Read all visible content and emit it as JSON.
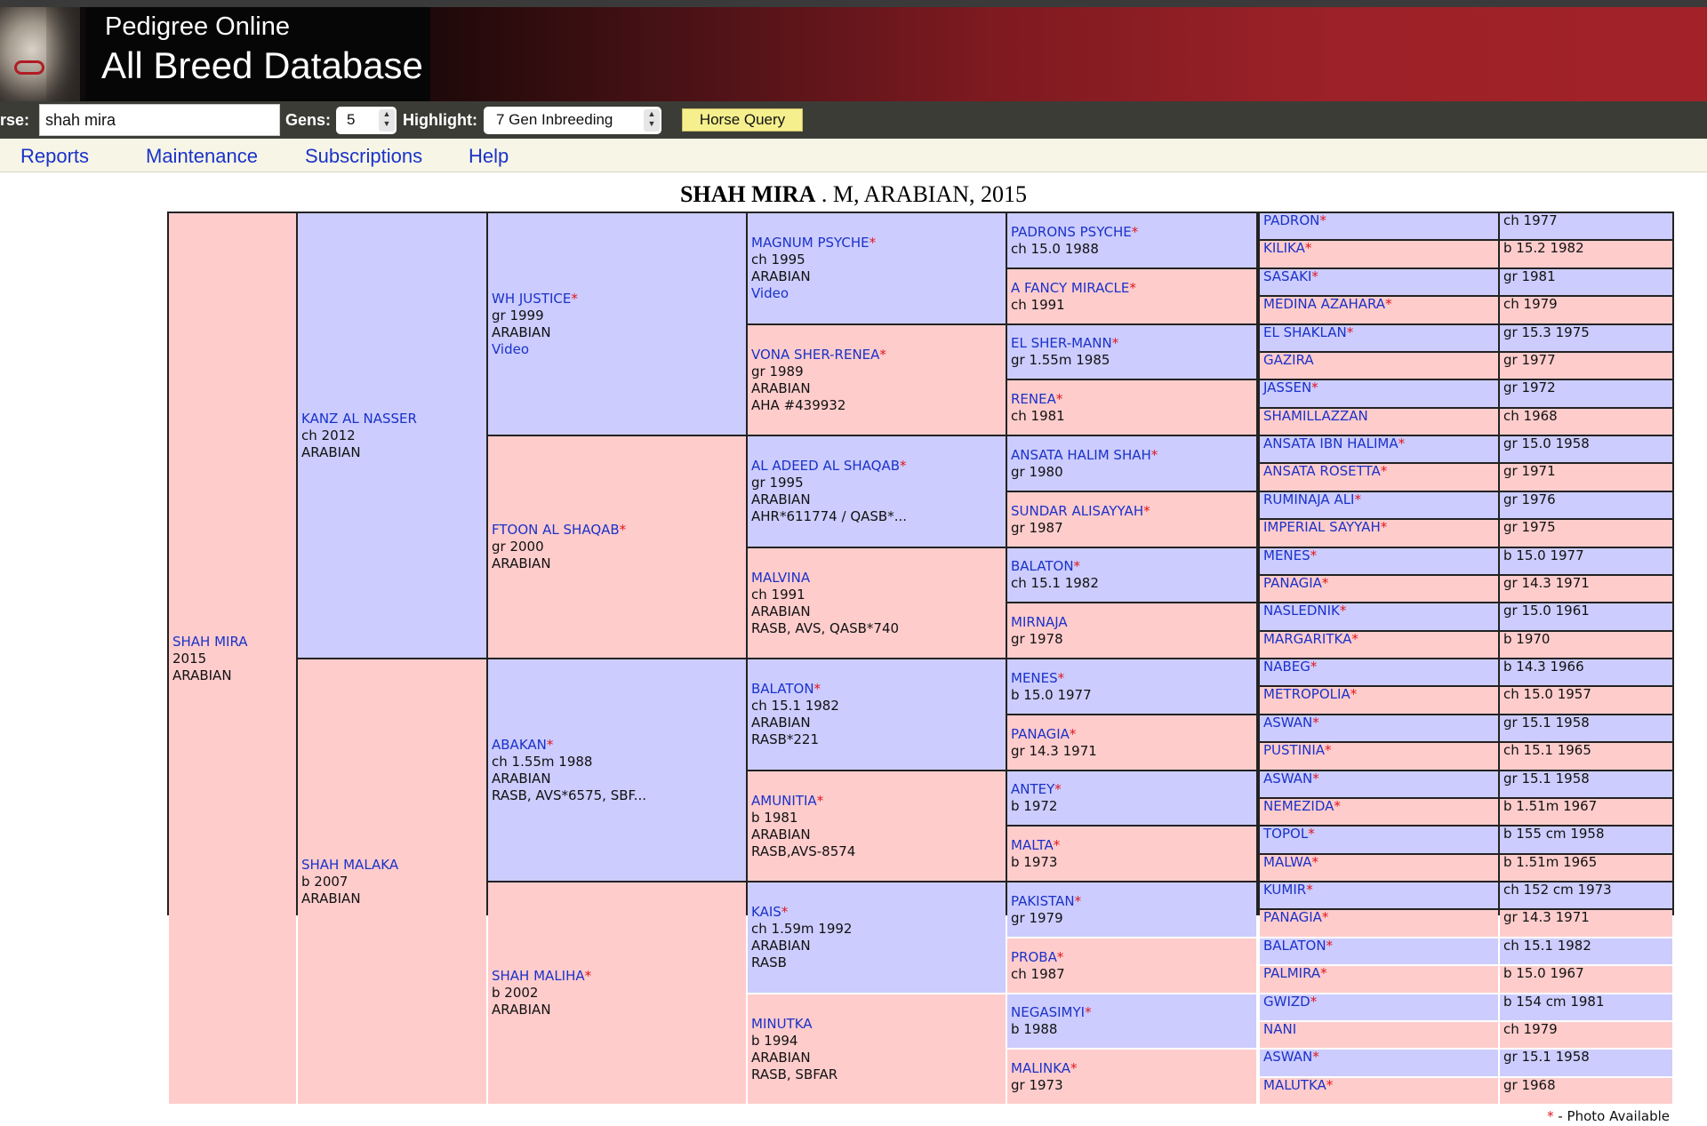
{
  "header": {
    "title_line1": "Pedigree Online",
    "title_line2": "All Breed Database"
  },
  "query": {
    "horse_label": "rse:",
    "horse_value": "shah mira",
    "gens_label": "Gens:",
    "gens_value": "5",
    "highlight_label": "Highlight:",
    "highlight_value": "7 Gen Inbreeding",
    "query_button": "Horse Query"
  },
  "menu": [
    "Reports",
    "Maintenance",
    "Subscriptions",
    "Help"
  ],
  "title": {
    "name": "SHAH MIRA",
    "rest": " . M, ARABIAN, 2015"
  },
  "pedigree": {
    "gen1": [
      {
        "name": "SHAH MIRA",
        "star": false,
        "lines": [
          "2015",
          "ARABIAN"
        ]
      }
    ],
    "gen2": [
      {
        "name": "KANZ AL NASSER",
        "star": false,
        "lines": [
          "ch 2012",
          "ARABIAN"
        ]
      },
      {
        "name": "SHAH MALAKA",
        "star": false,
        "lines": [
          "b 2007",
          "ARABIAN"
        ]
      }
    ],
    "gen3": [
      {
        "name": "WH JUSTICE",
        "star": true,
        "lines": [
          "gr 1999",
          "ARABIAN"
        ],
        "link": "Video"
      },
      {
        "name": "FTOON AL SHAQAB",
        "star": true,
        "lines": [
          "gr 2000",
          "ARABIAN"
        ]
      },
      {
        "name": "ABAKAN",
        "star": true,
        "lines": [
          "ch 1.55m 1988",
          "ARABIAN",
          "RASB, AVS*6575, SBF..."
        ]
      },
      {
        "name": "SHAH MALIHA",
        "star": true,
        "lines": [
          "b 2002",
          "ARABIAN"
        ]
      }
    ],
    "gen4": [
      {
        "name": "MAGNUM PSYCHE",
        "star": true,
        "lines": [
          "ch 1995",
          "ARABIAN"
        ],
        "link": "Video"
      },
      {
        "name": "VONA SHER-RENEA",
        "star": true,
        "lines": [
          "gr 1989",
          "ARABIAN",
          "AHA #439932"
        ]
      },
      {
        "name": "AL ADEED AL SHAQAB",
        "star": true,
        "lines": [
          "gr 1995",
          "ARABIAN",
          "AHR*611774 / QASB*..."
        ]
      },
      {
        "name": "MALVINA",
        "star": false,
        "lines": [
          "ch 1991",
          "ARABIAN",
          "RASB, AVS, QASB*740"
        ]
      },
      {
        "name": "BALATON",
        "star": true,
        "lines": [
          "ch 15.1 1982",
          "ARABIAN",
          "RASB*221"
        ]
      },
      {
        "name": "AMUNITIA",
        "star": true,
        "lines": [
          "b 1981",
          "ARABIAN",
          "RASB,AVS-8574"
        ]
      },
      {
        "name": "KAIS",
        "star": true,
        "lines": [
          "ch 1.59m 1992",
          "ARABIAN",
          "RASB"
        ]
      },
      {
        "name": "MINUTKA",
        "star": false,
        "lines": [
          "b 1994",
          "ARABIAN",
          "RASB, SBFAR"
        ]
      }
    ],
    "gen5": [
      {
        "name": "PADRONS PSYCHE",
        "star": true,
        "info": "ch 15.0 1988"
      },
      {
        "name": "A FANCY MIRACLE",
        "star": true,
        "info": "ch 1991"
      },
      {
        "name": "EL SHER-MANN",
        "star": true,
        "info": "gr 1.55m 1985"
      },
      {
        "name": "RENEA",
        "star": true,
        "info": "ch 1981"
      },
      {
        "name": "ANSATA HALIM SHAH",
        "star": true,
        "info": "gr 1980"
      },
      {
        "name": "SUNDAR ALISAYYAH",
        "star": true,
        "info": "gr 1987"
      },
      {
        "name": "BALATON",
        "star": true,
        "info": "ch 15.1 1982"
      },
      {
        "name": "MIRNAJA",
        "star": false,
        "info": "gr 1978"
      },
      {
        "name": "MENES",
        "star": true,
        "info": "b 15.0 1977"
      },
      {
        "name": "PANAGIA",
        "star": true,
        "info": "gr 14.3 1971"
      },
      {
        "name": "ANTEY",
        "star": true,
        "info": "b 1972"
      },
      {
        "name": "MALTA",
        "star": true,
        "info": "b 1973"
      },
      {
        "name": "PAKISTAN",
        "star": true,
        "info": "gr 1979"
      },
      {
        "name": "PROBA",
        "star": true,
        "info": "ch 1987"
      },
      {
        "name": "NEGASIMYI",
        "star": true,
        "info": "b 1988"
      },
      {
        "name": "MALINKA",
        "star": true,
        "info": "gr 1973"
      }
    ],
    "gen6": [
      {
        "name": "PADRON",
        "star": true,
        "info": "ch 1977"
      },
      {
        "name": "KILIKA",
        "star": true,
        "info": "b 15.2 1982"
      },
      {
        "name": "SASAKI",
        "star": true,
        "info": "gr 1981"
      },
      {
        "name": "MEDINA AZAHARA",
        "star": true,
        "info": "ch 1979"
      },
      {
        "name": "EL SHAKLAN",
        "star": true,
        "info": "gr 15.3 1975"
      },
      {
        "name": "GAZIRA",
        "star": false,
        "info": "gr 1977"
      },
      {
        "name": "JASSEN",
        "star": true,
        "info": "gr 1972"
      },
      {
        "name": "SHAMILLAZZAN",
        "star": false,
        "info": "ch 1968"
      },
      {
        "name": "ANSATA IBN HALIMA",
        "star": true,
        "info": "gr 15.0 1958"
      },
      {
        "name": "ANSATA ROSETTA",
        "star": true,
        "info": "gr 1971"
      },
      {
        "name": "RUMINAJA ALI",
        "star": true,
        "info": "gr 1976"
      },
      {
        "name": "IMPERIAL SAYYAH",
        "star": true,
        "info": "gr 1975"
      },
      {
        "name": "MENES",
        "star": true,
        "info": "b 15.0 1977"
      },
      {
        "name": "PANAGIA",
        "star": true,
        "info": "gr 14.3 1971"
      },
      {
        "name": "NASLEDNIK",
        "star": true,
        "info": "gr 15.0 1961"
      },
      {
        "name": "MARGARITKA",
        "star": true,
        "info": "b 1970"
      },
      {
        "name": "NABEG",
        "star": true,
        "info": "b 14.3 1966"
      },
      {
        "name": "METROPOLIA",
        "star": true,
        "info": "ch 15.0 1957"
      },
      {
        "name": "ASWAN",
        "star": true,
        "info": "gr 15.1 1958"
      },
      {
        "name": "PUSTINIA",
        "star": true,
        "info": "ch 15.1 1965"
      },
      {
        "name": "ASWAN",
        "star": true,
        "info": "gr 15.1 1958"
      },
      {
        "name": "NEMEZIDA",
        "star": true,
        "info": "b 1.51m 1967"
      },
      {
        "name": "TOPOL",
        "star": true,
        "info": "b 155 cm 1958"
      },
      {
        "name": "MALWA",
        "star": true,
        "info": "b 1.51m 1965"
      },
      {
        "name": "KUMIR",
        "star": true,
        "info": "ch 152 cm 1973"
      },
      {
        "name": "PANAGIA",
        "star": true,
        "info": "gr 14.3 1971"
      },
      {
        "name": "BALATON",
        "star": true,
        "info": "ch 15.1 1982"
      },
      {
        "name": "PALMIRA",
        "star": true,
        "info": "b 15.0 1967"
      },
      {
        "name": "GWIZD",
        "star": true,
        "info": "b 154 cm 1981"
      },
      {
        "name": "NANI",
        "star": false,
        "info": "ch 1979"
      },
      {
        "name": "ASWAN",
        "star": true,
        "info": "gr 15.1 1958"
      },
      {
        "name": "MALUTKA",
        "star": true,
        "info": "gr 1968"
      }
    ],
    "legend": {
      "star": "*",
      "text": " - Photo Available"
    }
  }
}
